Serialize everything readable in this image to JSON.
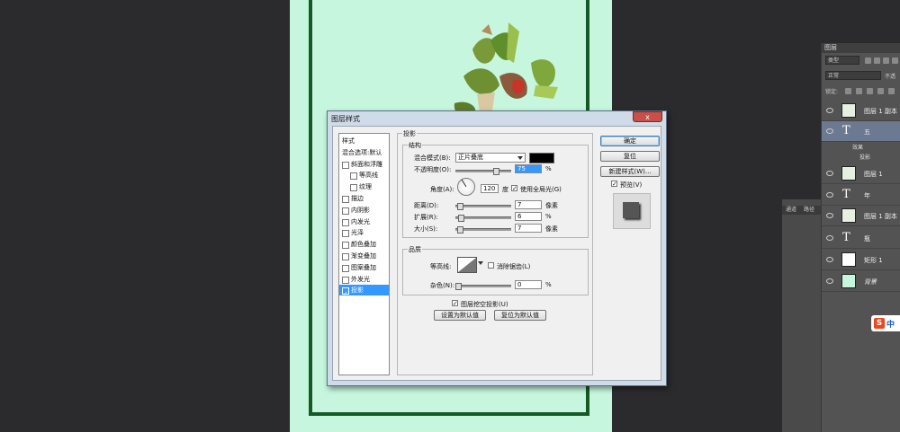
{
  "layers_panel": {
    "tab_label": "图层",
    "kind_filter": "类型",
    "blend_mode": "正常",
    "opacity_label": "不透",
    "lock_label": "锁定:",
    "layers": [
      {
        "name": "图层 1 副本",
        "kind": "image",
        "selected": false
      },
      {
        "name": "五",
        "kind": "text",
        "selected": true
      },
      {
        "name": "图层 1",
        "kind": "image",
        "selected": false
      },
      {
        "name": "年",
        "kind": "text",
        "selected": false
      },
      {
        "name": "图层 1 副本",
        "kind": "image",
        "selected": false
      },
      {
        "name": "瓶",
        "kind": "text",
        "selected": false
      },
      {
        "name": "矩形 1",
        "kind": "shape",
        "selected": false
      },
      {
        "name": "背景",
        "kind": "background",
        "selected": false
      }
    ],
    "effects_label": "效果",
    "effect_item": "投影"
  },
  "side_panel": {
    "tab1": "通道",
    "tab2": "路径"
  },
  "ime_badge": {
    "logo": "S",
    "text": "中"
  },
  "dialog": {
    "title": "图层样式",
    "close_glyph": "x",
    "styles_list": [
      {
        "label": "样式",
        "has_check": false,
        "checked": false,
        "indent": 0,
        "selected": false
      },
      {
        "label": "混合选项:默认",
        "has_check": false,
        "checked": false,
        "indent": 0,
        "selected": false
      },
      {
        "label": "斜面和浮雕",
        "has_check": true,
        "checked": false,
        "indent": 0,
        "selected": false
      },
      {
        "label": "等高线",
        "has_check": true,
        "checked": false,
        "indent": 1,
        "selected": false
      },
      {
        "label": "纹理",
        "has_check": true,
        "checked": false,
        "indent": 1,
        "selected": false
      },
      {
        "label": "描边",
        "has_check": true,
        "checked": false,
        "indent": 0,
        "selected": false
      },
      {
        "label": "内阴影",
        "has_check": true,
        "checked": false,
        "indent": 0,
        "selected": false
      },
      {
        "label": "内发光",
        "has_check": true,
        "checked": false,
        "indent": 0,
        "selected": false
      },
      {
        "label": "光泽",
        "has_check": true,
        "checked": false,
        "indent": 0,
        "selected": false
      },
      {
        "label": "颜色叠加",
        "has_check": true,
        "checked": false,
        "indent": 0,
        "selected": false
      },
      {
        "label": "渐变叠加",
        "has_check": true,
        "checked": false,
        "indent": 0,
        "selected": false
      },
      {
        "label": "图案叠加",
        "has_check": true,
        "checked": false,
        "indent": 0,
        "selected": false
      },
      {
        "label": "外发光",
        "has_check": true,
        "checked": false,
        "indent": 0,
        "selected": false
      },
      {
        "label": "投影",
        "has_check": true,
        "checked": true,
        "indent": 0,
        "selected": true
      }
    ],
    "section_title": "投影",
    "structure": {
      "legend": "结构",
      "blend_mode_label": "混合模式(B):",
      "blend_mode_value": "正片叠底",
      "color": "#000000",
      "opacity_label": "不透明度(O):",
      "opacity_value": "75",
      "opacity_fraction": 0.75,
      "percent": "%",
      "angle_label": "角度(A):",
      "angle_value": "120",
      "angle_unit": "度",
      "global_light_label": "使用全局光(G)",
      "global_light_checked": true,
      "distance_label": "距离(D):",
      "distance_value": "7",
      "distance_fraction": 0.03,
      "spread_label": "扩展(R):",
      "spread_value": "6",
      "spread_fraction": 0.06,
      "size_label": "大小(S):",
      "size_value": "7",
      "size_fraction": 0.03,
      "px_unit": "像素"
    },
    "quality": {
      "legend": "品质",
      "contour_label": "等高线:",
      "antialias_label": "消除锯齿(L)",
      "antialias_checked": false,
      "noise_label": "杂色(N):",
      "noise_value": "0",
      "noise_fraction": 0.0
    },
    "knockout_label": "图层挖空投影(U)",
    "knockout_checked": true,
    "make_default": "设置为默认值",
    "reset_default": "复位为默认值",
    "ok": "确定",
    "reset": "复位",
    "new_style": "新建样式(W)...",
    "preview_label": "预览(V)",
    "preview_checked": true,
    "check_mark": "✓"
  }
}
